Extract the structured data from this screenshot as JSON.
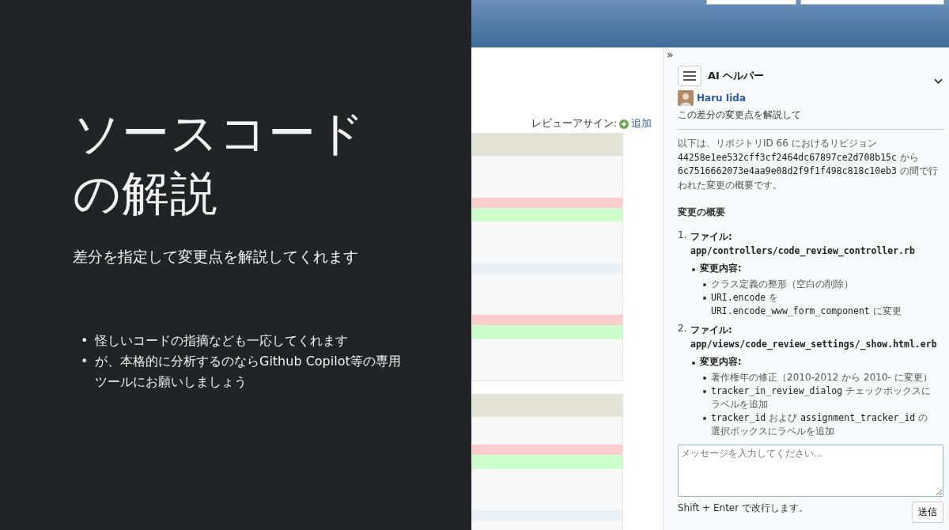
{
  "slide": {
    "title": "ソースコードの解説",
    "subtitle": "差分を指定して変更点を解説してくれます",
    "bullets": [
      {
        "marker": "•",
        "text": "怪しいコードの指摘なども一応してくれます"
      },
      {
        "marker": "•",
        "text": "が、本格的に分析するのならGithub Copilot等の専用ツールにお願いしましょう"
      }
    ]
  },
  "app": {
    "reviewer_label": "レビューアサイン:",
    "add_link": "追加",
    "diff_blocks": [
      {
        "rows": [
          {
            "kind": "header"
          },
          {
            "kind": "context"
          },
          {
            "kind": "context"
          },
          {
            "kind": "context"
          },
          {
            "kind": "removed"
          },
          {
            "kind": "added"
          },
          {
            "kind": "context"
          },
          {
            "kind": "context"
          },
          {
            "kind": "context"
          },
          {
            "kind": "separator"
          },
          {
            "kind": "context"
          },
          {
            "kind": "context"
          },
          {
            "kind": "context"
          },
          {
            "kind": "removed"
          },
          {
            "kind": "added"
          },
          {
            "kind": "context"
          },
          {
            "kind": "context"
          },
          {
            "kind": "context"
          }
        ]
      },
      {
        "rows": [
          {
            "kind": "header"
          },
          {
            "kind": "context"
          },
          {
            "kind": "context"
          },
          {
            "kind": "removed"
          },
          {
            "kind": "added"
          },
          {
            "kind": "context"
          },
          {
            "kind": "context"
          },
          {
            "kind": "context"
          },
          {
            "kind": "separator"
          },
          {
            "kind": "context"
          }
        ]
      }
    ],
    "sidebar": {
      "collapse": "»",
      "title": "AI ヘルパー",
      "user": "Haru Iida",
      "prompt": "この差分の変更点を解説して",
      "intro": [
        {
          "text": "以下は、リポジトリID 66 におけるリビジョン ",
          "code": false
        },
        {
          "text": "44258e1ee532cff3cf2464dc67897ce2d708b15c",
          "code": true
        },
        {
          "text": " から ",
          "code": false
        },
        {
          "text": "6c7516662073e4aa9e08d2f9f1f498c818c10eb3",
          "code": true
        },
        {
          "text": " の間で行われた変更の概要です。",
          "code": false
        }
      ],
      "heading": "変更の概要",
      "files": [
        {
          "number": "1.",
          "label": "ファイル:",
          "path": "app/controllers/code_review_controller.rb",
          "change_label": "変更内容:",
          "changes": [
            [
              {
                "text": "クラス定義の整形（空白の削除）",
                "code": false
              }
            ],
            [
              {
                "text": "URI.encode",
                "code": true
              },
              {
                "text": " を ",
                "code": false
              },
              {
                "text": "URI.encode_www_form_component",
                "code": true
              },
              {
                "text": " に変更",
                "code": false
              }
            ]
          ]
        },
        {
          "number": "2.",
          "label": "ファイル:",
          "path": "app/views/code_review_settings/_show.html.erb",
          "change_label": "変更内容:",
          "changes": [
            [
              {
                "text": "著作権年の修正（2010-2012 から 2010- に変更）",
                "code": false
              }
            ],
            [
              {
                "text": "tracker_in_review_dialog",
                "code": true
              },
              {
                "text": " チェックボックスにラベルを追加",
                "code": false
              }
            ],
            [
              {
                "text": "tracker_id",
                "code": true
              },
              {
                "text": " および ",
                "code": false
              },
              {
                "text": "assignment_tracker_id",
                "code": true
              },
              {
                "text": " の選択ボックスにラベルを追加",
                "code": false
              }
            ]
          ]
        }
      ],
      "input_placeholder": "メッセージを入力してください...",
      "hint": "Shift + Enter で改行します。",
      "send": "送信"
    }
  }
}
